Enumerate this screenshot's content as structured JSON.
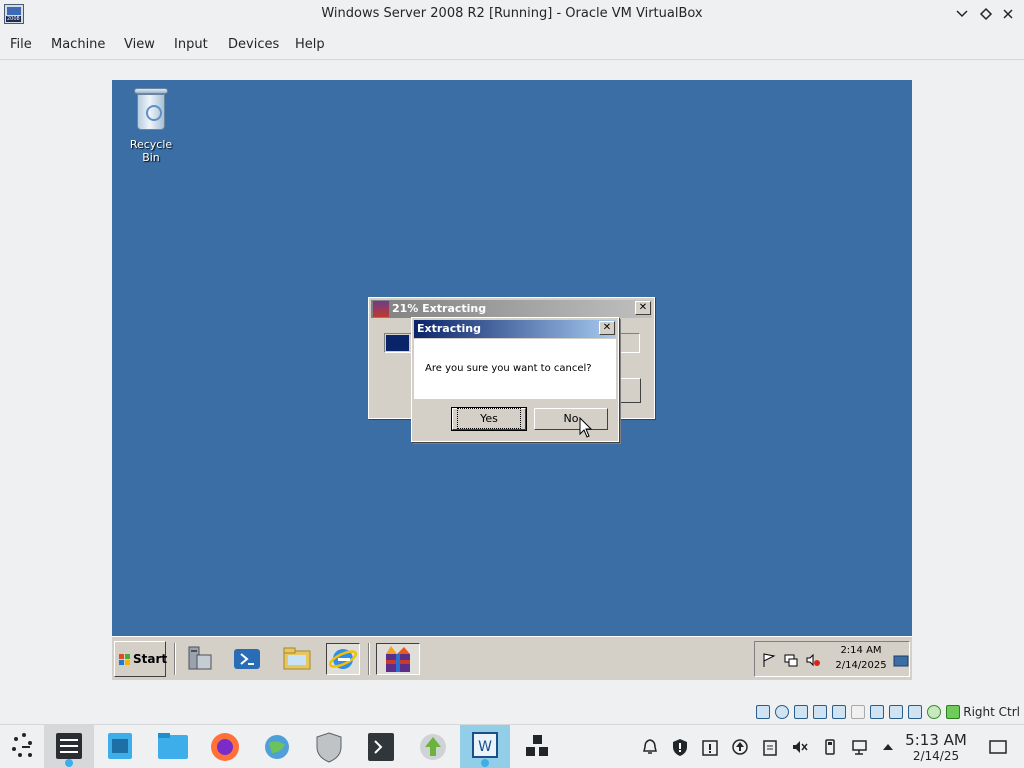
{
  "host_window": {
    "title": "Windows Server 2008 R2 [Running] - Oracle VM VirtualBox",
    "app_icon_tag": "2008",
    "controls": [
      "minimize",
      "maximize",
      "close"
    ]
  },
  "menu": {
    "items": [
      "File",
      "Machine",
      "View",
      "Input",
      "Devices",
      "Help"
    ]
  },
  "guest": {
    "desktop": {
      "background_color": "#3a6ea5",
      "recycle_bin_label": "Recycle Bin"
    },
    "back_dialog": {
      "title": "21% Extracting",
      "progress_fraction": 0.09,
      "close_glyph": "✕"
    },
    "front_dialog": {
      "title": "Extracting",
      "message": "Are you sure you want to cancel?",
      "yes_label": "Yes",
      "no_label": "No",
      "close_glyph": "✕"
    },
    "taskbar": {
      "start_label": "Start",
      "quick_launch_icons": [
        "server-manager-icon",
        "powershell-icon",
        "explorer-icon",
        "internet-explorer-icon"
      ],
      "running_task_icon": "winrar-icon",
      "clock_time": "2:14 AM",
      "clock_date": "2/14/2025"
    }
  },
  "vbox_status": {
    "host_key_label": "Right Ctrl"
  },
  "host_panel": {
    "clock_time": "5:13 AM",
    "clock_date": "2/14/25",
    "tasks": [
      "application-launcher",
      "system-settings",
      "discover",
      "file-manager",
      "firefox",
      "network-browser",
      "security",
      "terminal",
      "updater",
      "virtualbox-vm",
      "virtualbox-manager"
    ],
    "accent_color": "#93cee9"
  }
}
